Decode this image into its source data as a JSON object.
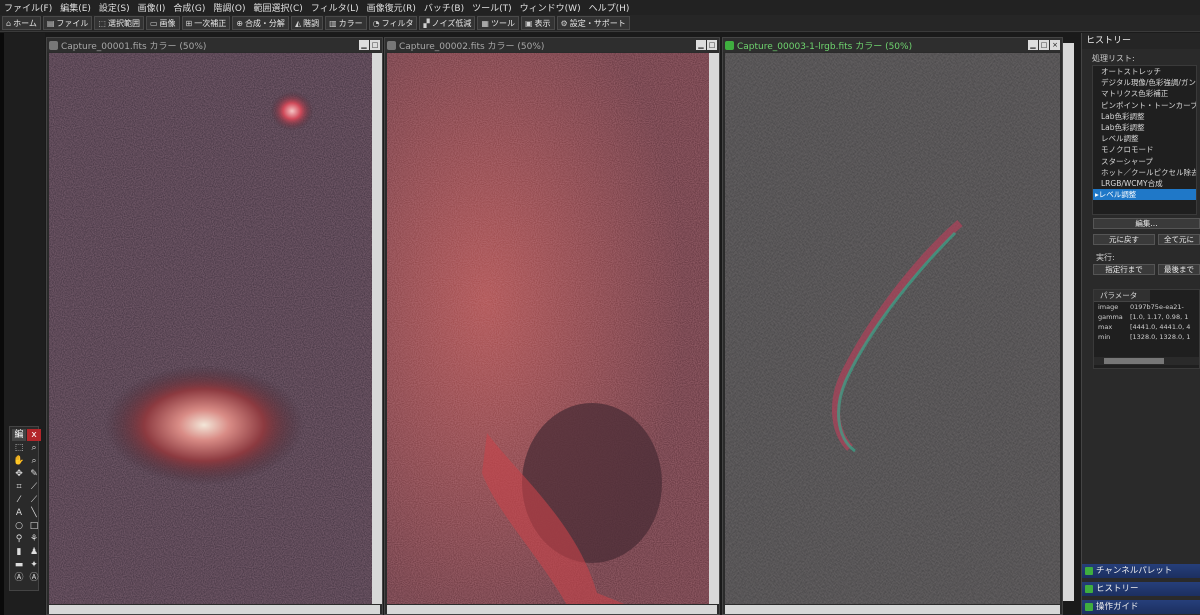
{
  "menu": [
    "ファイル(F)",
    "編集(E)",
    "設定(S)",
    "画像(I)",
    "合成(G)",
    "階調(O)",
    "範囲選択(C)",
    "フィルタ(L)",
    "画像復元(R)",
    "バッチ(B)",
    "ツール(T)",
    "ウィンドウ(W)",
    "ヘルプ(H)"
  ],
  "toolbar": [
    {
      "icon": "home-icon",
      "glyph": "⌂",
      "label": "ホーム"
    },
    {
      "icon": "file-icon",
      "glyph": "▤",
      "label": "ファイル"
    },
    {
      "icon": "selection-icon",
      "glyph": "⬚",
      "label": "選択範囲"
    },
    {
      "icon": "image-icon",
      "glyph": "▭",
      "label": "画像"
    },
    {
      "icon": "primary-correction-icon",
      "glyph": "⊞",
      "label": "一次補正"
    },
    {
      "icon": "composite-icon",
      "glyph": "⊕",
      "label": "合成・分解"
    },
    {
      "icon": "tone-icon",
      "glyph": "◭",
      "label": "階調"
    },
    {
      "icon": "color-icon",
      "glyph": "▥",
      "label": "カラー"
    },
    {
      "icon": "filter-icon",
      "glyph": "◔",
      "label": "フィルタ"
    },
    {
      "icon": "noise-reduction-icon",
      "glyph": "▞",
      "label": "ノイズ低減"
    },
    {
      "icon": "tools-icon",
      "glyph": "▦",
      "label": "ツール"
    },
    {
      "icon": "display-icon",
      "glyph": "▣",
      "label": "表示"
    },
    {
      "icon": "settings-icon",
      "glyph": "⚙",
      "label": "設定・サポート"
    }
  ],
  "windows": [
    {
      "title": "Capture_00001.fits カラー (50%)",
      "active": false
    },
    {
      "title": "Capture_00002.fits カラー (50%)",
      "active": false
    },
    {
      "title": "Capture_00003-1-lrgb.fits カラー (50%)",
      "active": true
    }
  ],
  "toolbox": {
    "header": "編",
    "close": "x"
  },
  "history_panel": {
    "title": "ヒストリー",
    "list_label": "処理リスト:",
    "items": [
      "オートストレッチ",
      "デジタル現像/色彩強調/ガンマ",
      "マトリクス色彩補正",
      "ピンポイント・トーンカーブ",
      "Lab色彩調整",
      "Lab色彩調整",
      "レベル調整",
      "モノクロモード",
      "スターシャープ",
      "ホット／クールピクセル除去",
      "LRGB/WCMY合成",
      "レベル調整"
    ],
    "selected_index": 11,
    "edit_button": "編集...",
    "undo_button": "元に戻す",
    "undo_all_button": "全て元に",
    "execute_label": "実行:",
    "run_to_selected_button": "指定行まで",
    "run_to_last_button": "最後まで",
    "params_header": "パラメータ",
    "params": [
      {
        "key": "image",
        "value": "0197b75e-ea21-"
      },
      {
        "key": "gamma",
        "value": "[1.0, 1.17, 0.98, 1"
      },
      {
        "key": "max",
        "value": "[4441.0, 4441.0, 4"
      },
      {
        "key": "min",
        "value": "[1328.0, 1328.0, 1"
      }
    ]
  },
  "docks": [
    "チャンネルパレット",
    "ヒストリー",
    "操作ガイド"
  ]
}
